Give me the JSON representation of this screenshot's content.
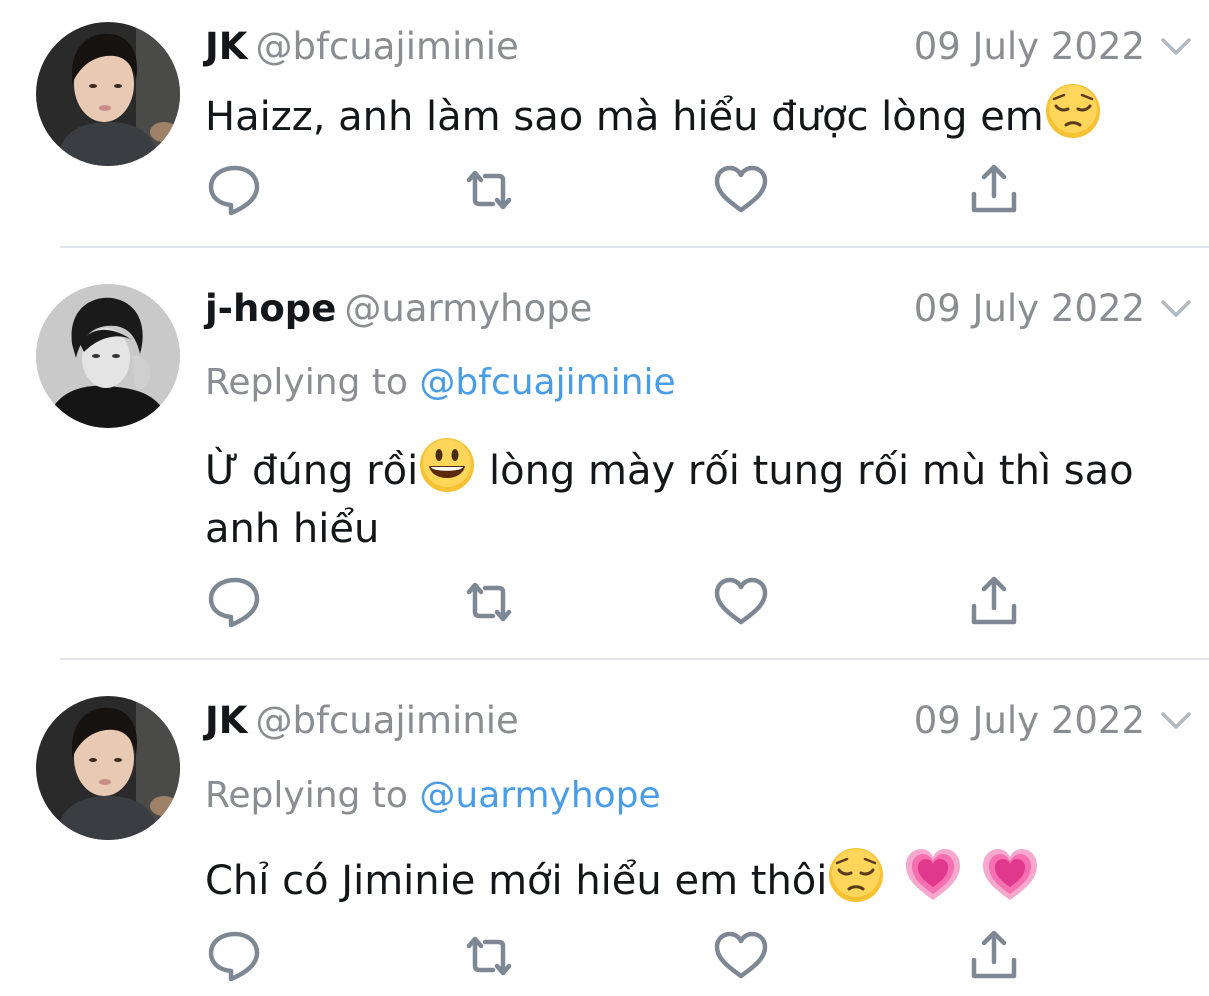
{
  "tweets": [
    {
      "name": "JK",
      "handle": "@bfcuajiminie",
      "date": "09 July 2022",
      "replying_label": "",
      "replying_to": "",
      "text_parts": [
        "Haizz, anh làm sao mà hiểu được lòng em"
      ],
      "emojis": [
        "pensive-face"
      ]
    },
    {
      "name": "j-hope",
      "handle": "@uarmyhope",
      "date": "09 July 2022",
      "replying_label": "Replying to",
      "replying_to": "@bfcuajiminie",
      "text_parts": [
        "Ừ đúng rồi",
        " lòng mày rối tung rối mù thì sao anh hiểu"
      ],
      "emojis": [
        "grinning-face"
      ]
    },
    {
      "name": "JK",
      "handle": "@bfcuajiminie",
      "date": "09 July 2022",
      "replying_label": "Replying to",
      "replying_to": "@uarmyhope",
      "text_parts": [
        "Chỉ có Jiminie mới hiểu em thôi"
      ],
      "emojis": [
        "pensive-face",
        "growing-heart",
        "growing-heart"
      ]
    }
  ],
  "actions": [
    "reply-icon",
    "retweet-icon",
    "like-icon",
    "share-icon"
  ],
  "colors": {
    "text": "#14171a",
    "secondary": "#8a8d91",
    "link": "#4a9de4",
    "icon": "#7d8894",
    "divider": "#e1e4e8"
  }
}
